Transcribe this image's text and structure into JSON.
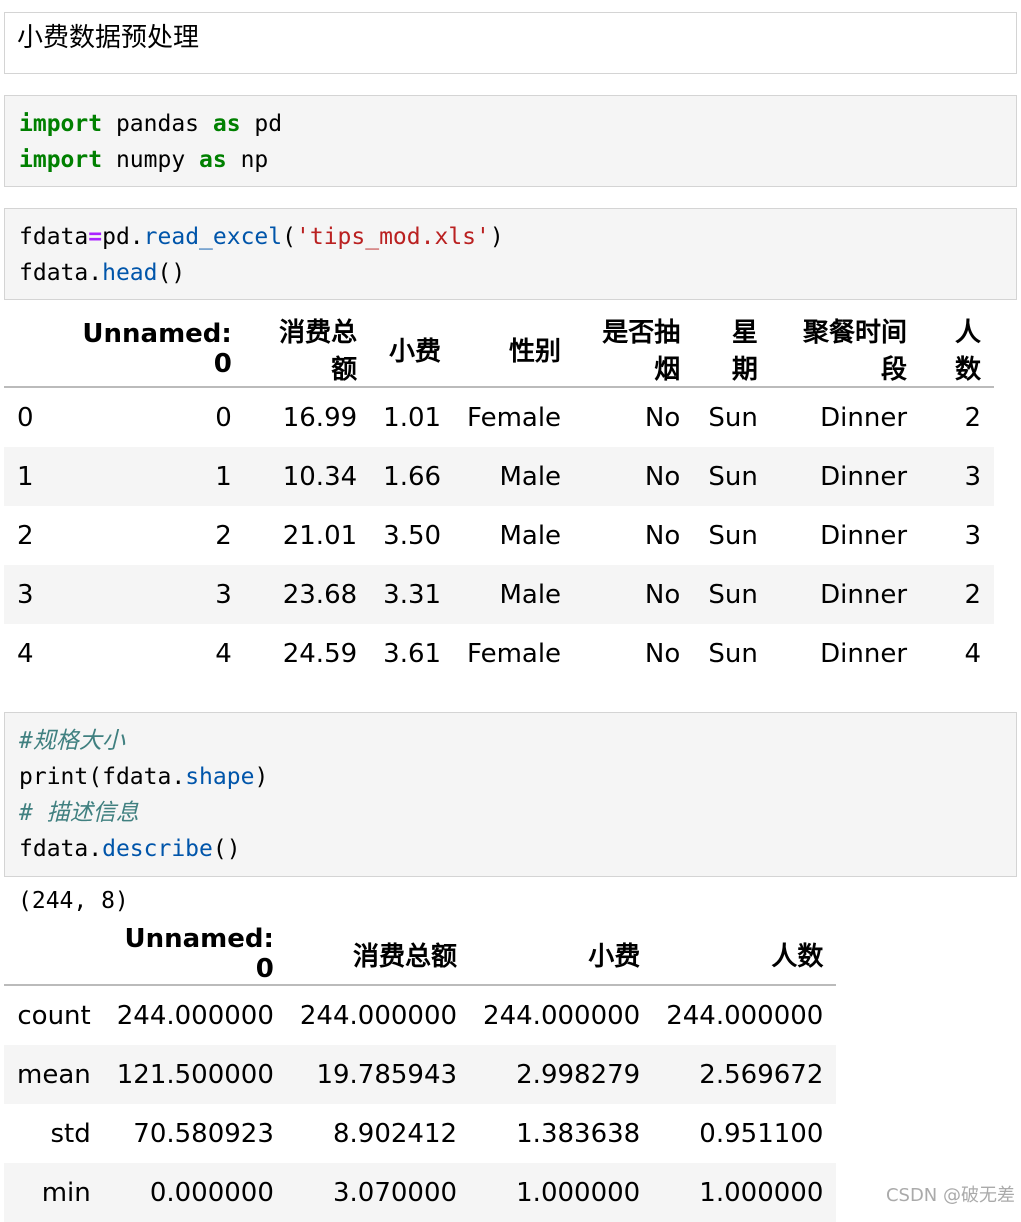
{
  "markdown": {
    "text": "小费数据预处理"
  },
  "code1": {
    "line1": {
      "kw1": "import",
      "mod": " pandas ",
      "kw2": "as",
      "alias": " pd"
    },
    "line2": {
      "kw1": "import",
      "mod": " numpy ",
      "kw2": "as",
      "alias": " np"
    }
  },
  "code2": {
    "line1": {
      "var": "fdata",
      "op": "=",
      "obj": "pd.",
      "fn": "read_excel",
      "open": "(",
      "str": "'tips_mod.xls'",
      "close": ")"
    },
    "line2": {
      "obj": "fdata.",
      "fn": "head",
      "call": "()"
    }
  },
  "table1": {
    "columns": [
      "",
      "Unnamed: 0",
      "消费总额",
      "小费",
      "性别",
      "是否抽烟",
      "星期",
      "聚餐时间段",
      "人数"
    ],
    "rows": [
      [
        "0",
        "0",
        "16.99",
        "1.01",
        "Female",
        "No",
        "Sun",
        "Dinner",
        "2"
      ],
      [
        "1",
        "1",
        "10.34",
        "1.66",
        "Male",
        "No",
        "Sun",
        "Dinner",
        "3"
      ],
      [
        "2",
        "2",
        "21.01",
        "3.50",
        "Male",
        "No",
        "Sun",
        "Dinner",
        "3"
      ],
      [
        "3",
        "3",
        "23.68",
        "3.31",
        "Male",
        "No",
        "Sun",
        "Dinner",
        "2"
      ],
      [
        "4",
        "4",
        "24.59",
        "3.61",
        "Female",
        "No",
        "Sun",
        "Dinner",
        "4"
      ]
    ]
  },
  "code3": {
    "comment1": "#规格大小",
    "line2": {
      "print": "print(",
      "obj": "fdata.",
      "attr": "shape",
      "close": ")"
    },
    "comment2": "# 描述信息",
    "line4": {
      "obj": "fdata.",
      "fn": "describe",
      "call": "()"
    }
  },
  "output": {
    "shape": "(244, 8)"
  },
  "table2": {
    "columns": [
      "",
      "Unnamed: 0",
      "消费总额",
      "小费",
      "人数"
    ],
    "rows": [
      [
        "count",
        "244.000000",
        "244.000000",
        "244.000000",
        "244.000000"
      ],
      [
        "mean",
        "121.500000",
        "19.785943",
        "2.998279",
        "2.569672"
      ],
      [
        "std",
        "70.580923",
        "8.902412",
        "1.383638",
        "0.951100"
      ],
      [
        "min",
        "0.000000",
        "3.070000",
        "1.000000",
        "1.000000"
      ]
    ]
  },
  "watermark": "CSDN @破无差"
}
